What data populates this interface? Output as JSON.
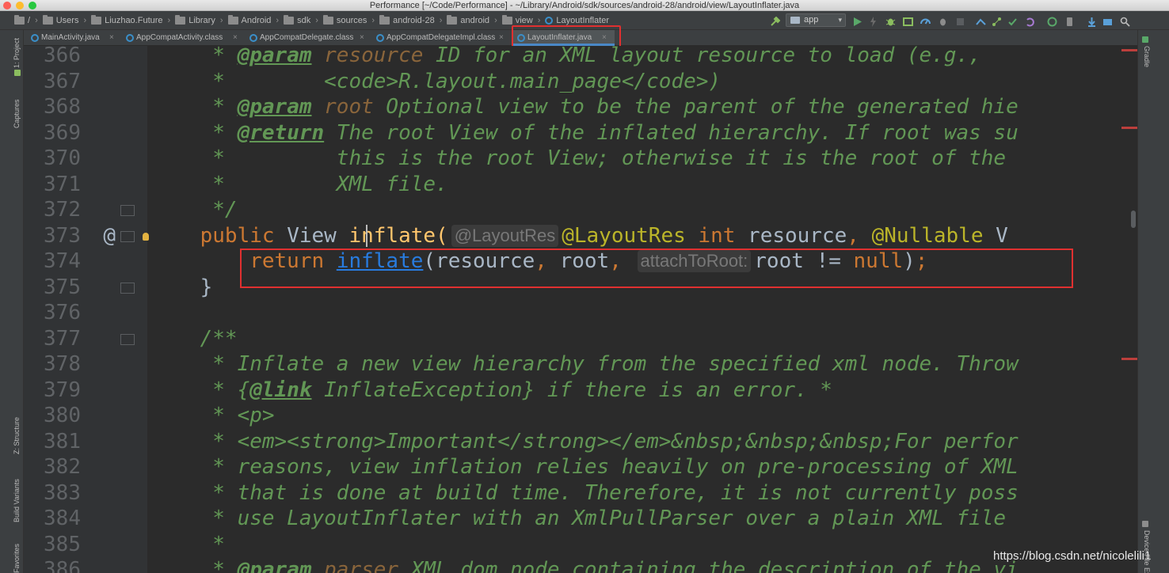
{
  "window": {
    "title": "Performance [~/Code/Performance] - ~/Library/Android/sdk/sources/android-28/android/view/LayoutInflater.java"
  },
  "breadcrumbs": [
    {
      "label": "/",
      "icon": "folder-icon"
    },
    {
      "label": "Users",
      "icon": "folder-icon"
    },
    {
      "label": "Liuzhao.Future",
      "icon": "folder-icon"
    },
    {
      "label": "Library",
      "icon": "folder-icon"
    },
    {
      "label": "Android",
      "icon": "folder-icon"
    },
    {
      "label": "sdk",
      "icon": "folder-icon"
    },
    {
      "label": "sources",
      "icon": "folder-icon"
    },
    {
      "label": "android-28",
      "icon": "folder-icon"
    },
    {
      "label": "android",
      "icon": "folder-icon"
    },
    {
      "label": "view",
      "icon": "folder-icon"
    },
    {
      "label": "LayoutInflater",
      "icon": "class-icon"
    }
  ],
  "run_config": {
    "label": "app"
  },
  "tabs": [
    {
      "label": "MainActivity.java",
      "active": false
    },
    {
      "label": "AppCompatActivity.class",
      "active": false
    },
    {
      "label": "AppCompatDelegate.class",
      "active": false
    },
    {
      "label": "AppCompatDelegateImpl.class",
      "active": false
    },
    {
      "label": "LayoutInflater.java",
      "active": true
    }
  ],
  "left_tool_windows": [
    "1: Project",
    "Captures",
    "Z: Structure",
    "Build Variants",
    "Favorites"
  ],
  "right_tool_windows": [
    "Gradle",
    "Device File Explorer"
  ],
  "editor": {
    "lines": [
      {
        "n": "366",
        "segs": [
          [
            "doc",
            "     * "
          ],
          [
            "doctag",
            "@param"
          ],
          [
            "doc",
            " "
          ],
          [
            "docparam",
            "resource"
          ],
          [
            "doc",
            " ID for an XML layout resource to load (e.g.,"
          ]
        ]
      },
      {
        "n": "367",
        "segs": [
          [
            "doc",
            "     *        <code>R.layout.main_page</code>)"
          ]
        ]
      },
      {
        "n": "368",
        "segs": [
          [
            "doc",
            "     * "
          ],
          [
            "doctag",
            "@param"
          ],
          [
            "doc",
            " "
          ],
          [
            "docparam",
            "root"
          ],
          [
            "doc",
            " Optional view to be the parent of the generated hie"
          ]
        ]
      },
      {
        "n": "369",
        "segs": [
          [
            "doc",
            "     * "
          ],
          [
            "doctag",
            "@return"
          ],
          [
            "doc",
            " The root View of the inflated hierarchy. If root was su"
          ]
        ]
      },
      {
        "n": "370",
        "segs": [
          [
            "doc",
            "     *         this is the root View; otherwise it is the root of the"
          ]
        ]
      },
      {
        "n": "371",
        "segs": [
          [
            "doc",
            "     *         XML file."
          ]
        ]
      },
      {
        "n": "372",
        "segs": [
          [
            "doc",
            "     */"
          ]
        ]
      },
      {
        "n": "373",
        "segs": [
          [
            "kw",
            "    public "
          ],
          [
            "plain",
            "View "
          ],
          [
            "plain",
            "inflate("
          ],
          [
            "hint",
            "@LayoutRes"
          ],
          [
            "ann",
            "@LayoutRes"
          ],
          [
            "plain",
            " "
          ],
          [
            "kw",
            "int"
          ],
          [
            "plain",
            " resource"
          ],
          [
            "punct",
            ", "
          ],
          [
            "ann",
            "@Nullable"
          ],
          [
            "plain",
            " V"
          ]
        ]
      },
      {
        "n": "374",
        "segs": [
          [
            "kw",
            "        return "
          ],
          [
            "link",
            "inflate"
          ],
          [
            "plain",
            "(resource"
          ],
          [
            "punct",
            ", "
          ],
          [
            "plain",
            "root"
          ],
          [
            "punct",
            ", "
          ],
          [
            "hint",
            "attachToRoot:"
          ],
          [
            "plain",
            "root != "
          ],
          [
            "kw",
            "null"
          ],
          [
            "plain",
            ")"
          ],
          [
            "punct",
            ";"
          ]
        ]
      },
      {
        "n": "375",
        "segs": [
          [
            "plain",
            "    }"
          ]
        ]
      },
      {
        "n": "376",
        "segs": [
          [
            "plain",
            ""
          ]
        ]
      },
      {
        "n": "377",
        "segs": [
          [
            "doc",
            "    /**"
          ]
        ]
      },
      {
        "n": "378",
        "segs": [
          [
            "doc",
            "     * Inflate a new view hierarchy from the specified xml node. Throw"
          ]
        ]
      },
      {
        "n": "379",
        "segs": [
          [
            "doc",
            "     * {"
          ],
          [
            "doctag",
            "@link"
          ],
          [
            "doc",
            " InflateException} if there is an error. *"
          ]
        ]
      },
      {
        "n": "380",
        "segs": [
          [
            "doc",
            "     * <p>"
          ]
        ]
      },
      {
        "n": "381",
        "segs": [
          [
            "doc",
            "     * <em><strong>Important</strong></em>&nbsp;&nbsp;&nbsp;For perfor"
          ]
        ]
      },
      {
        "n": "382",
        "segs": [
          [
            "doc",
            "     * reasons, view inflation relies heavily on pre-processing of XML"
          ]
        ]
      },
      {
        "n": "383",
        "segs": [
          [
            "doc",
            "     * that is done at build time. Therefore, it is not currently poss"
          ]
        ]
      },
      {
        "n": "384",
        "segs": [
          [
            "doc",
            "     * use LayoutInflater with an XmlPullParser over a plain XML file"
          ]
        ]
      },
      {
        "n": "385",
        "segs": [
          [
            "doc",
            "     *"
          ]
        ]
      },
      {
        "n": "386",
        "segs": [
          [
            "doc",
            "     * "
          ],
          [
            "doctag",
            "@param"
          ],
          [
            "doc",
            " "
          ],
          [
            "docparam",
            "parser"
          ],
          [
            "doc",
            " XML dom node containing the description of the vi"
          ]
        ]
      }
    ],
    "gutter_marks": {
      "373": "@"
    }
  },
  "watermark": "https://blog.csdn.net/nicolelili1"
}
